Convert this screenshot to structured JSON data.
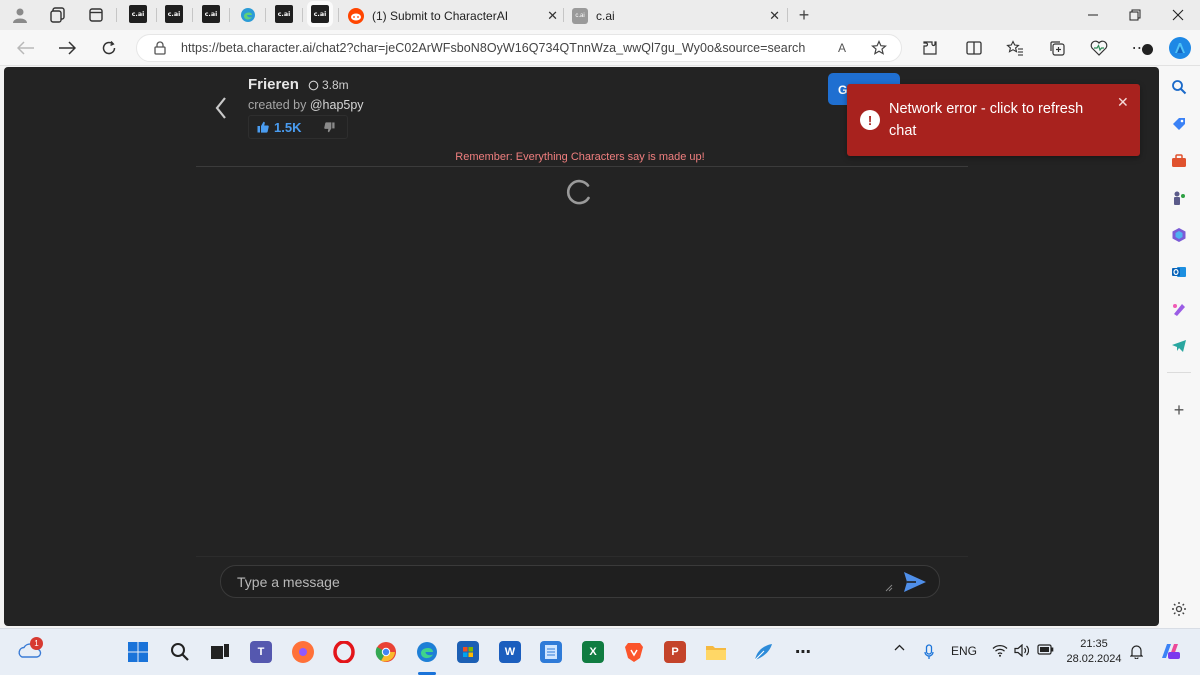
{
  "browser": {
    "tabs": [
      {
        "label": "c.ai"
      },
      {
        "label": "c.ai"
      },
      {
        "label": "c.ai"
      },
      {
        "label": "c.ai"
      },
      {
        "label": "c.ai"
      }
    ],
    "reddit_tab": {
      "label": "(1) Submit to CharacterAI"
    },
    "cai_tab": {
      "label": "c.ai",
      "icon_label": "c.ai"
    },
    "address": "https://beta.character.ai/chat2?char=jeC02ArWFsboN8OyW16Q734QTnnWza_wwQl7gu_Wy0o&source=search",
    "read_aloud_label": "A",
    "notification_count": ""
  },
  "character": {
    "name": "Frieren",
    "chat_count": "3.8m",
    "created_by_prefix": "created by",
    "creator_handle": "@hap5py",
    "likes": "1.5K"
  },
  "group_button": {
    "label": "G"
  },
  "disclaimer": "Remember: Everything Characters say is made up!",
  "message": {
    "placeholder": "Type a message"
  },
  "toast": {
    "message": "Network error - click to refresh chat",
    "close": "✕"
  },
  "taskbar": {
    "weather_badge": "1",
    "language": "ENG",
    "time": "21:35",
    "date": "28.02.2024"
  },
  "colors": {
    "accent": "#1f6fd1",
    "toast": "#a8221e",
    "disclaimer": "#f07f7f",
    "like": "#4a9cf0"
  }
}
